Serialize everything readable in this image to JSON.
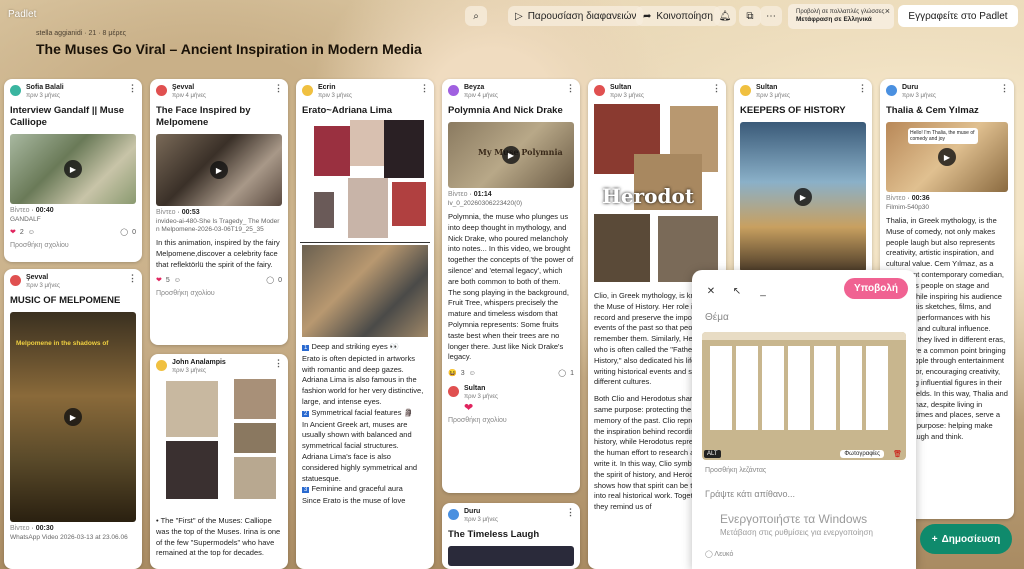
{
  "app": {
    "brand": "Padlet"
  },
  "toolbar": {
    "slideshow": "Παρουσίαση διαφανειών",
    "share": "Κοινοποίηση",
    "subscribe": "Εγγραφείτε στο Padlet",
    "lang_line1": "Προβολή σε πολλαπλές γλώσσες",
    "lang_line2": "Μετάφραση σε Ελληνικά"
  },
  "board": {
    "meta": "stella aggianidi · 21 · 8 μέρες",
    "title": "The Muses Go Viral – Ancient Inspiration in Modern Media"
  },
  "colors": {
    "accent": "#f06292",
    "publish": "#0f8a6c"
  },
  "cards": [
    {
      "author": "Sofia Balali",
      "time": "πριν 3 μήνες",
      "title": "Interview Gandalf || Muse Calliope",
      "video": "Βίντεο",
      "dur": "00:40",
      "file": "GANDALF",
      "likes": "2",
      "comments": "0",
      "add": "Προσθήκη σχολίου"
    },
    {
      "author": "Şevval",
      "time": "πριν 3 μήνες",
      "title": "MUSIC OF MELPOMENE",
      "overlay": "Melpomene in the shadows of",
      "video": "Βίντεο",
      "dur": "00:30",
      "file": "WhatsApp Video 2026-03-13 at 23.06.06"
    },
    {
      "author": "Şevval",
      "time": "πριν 4 μήνες",
      "title": "The Face Inspired by Melpomene",
      "video": "Βίντεο",
      "dur": "00:53",
      "file": "invideo-ai-480-She Is Tragedy_ The Modern Melpomene-2026-03-06T19_25_35",
      "body": "In this animation, inspired by the fairy Melpomene,discover a celebrity face that reflektörlü the spirit of the fairy.",
      "likes": "5",
      "comments": "0",
      "add": "Προσθήκη σχολίου"
    },
    {
      "author": "John Analampis",
      "time": "πριν 3 μήνες",
      "body": "• The \"First\" of the Muses: Calliope was the top of the Muses. Irina is one of the few \"Supermodels\" who have remained at the top for decades."
    },
    {
      "author": "Ecrin",
      "time": "πριν 3 μήνες",
      "title": "Erato~Adriana Lima",
      "p1h": "Deep and striking eyes 👀",
      "p1": "Erato is often depicted in artworks with romantic and deep gazes.",
      "p2": "Adriana Lima is also famous in the fashion world for her very distinctive, large, and intense eyes.",
      "p3h": "Symmetrical facial features 🗿",
      "p3": "In Ancient Greek art, muses are usually shown with balanced and symmetrical facial structures.",
      "p4": "Adriana Lima's face is also considered highly symmetrical and statuesque.",
      "p5h": "Feminine and graceful aura",
      "p5": "Since Erato is the muse of love"
    },
    {
      "author": "Beyza",
      "time": "πριν 4 μήνες",
      "title": "Polymnia And Nick Drake",
      "media_text": "My Muse Polymnia",
      "video": "Βίντεο",
      "dur": "01:14",
      "file": "lv_0_20260306223420(0)",
      "body": "Polymnia, the muse who plunges us into deep thought in mythology, and Nick Drake, who poured melancholy into notes... In this video, we brought together the concepts of 'the power of silence' and 'eternal legacy', which are both common to both of them. The song playing in the background, Fruit Tree, whispers precisely the mature and timeless wisdom that Polymnia represents: Some fruits taste best when their trees are no longer there.  Just like Nick Drake's legacy.",
      "likes": "3",
      "comments": "1",
      "reply_author": "Sultan",
      "reply_time": "πριν 3 μήνες",
      "add": "Προσθήκη σχολίου"
    },
    {
      "author": "Duru",
      "time": "πριν 3 μήνες",
      "title": "The Timeless Laugh"
    },
    {
      "author": "Sultan",
      "time": "πριν 3 μήνες",
      "media_text": "Herodot",
      "body1": "Clio, in Greek mythology, is known as the Muse of History. Her role is to record and preserve the important events of the past so that people can remember them. Similarly, Herodotus, who is often called the \"Father of History,\" also dedicated his life to writing historical events and stories of different cultures.",
      "body2": "Both Clio and Herodotus share the same purpose: protecting the memory of the past. Clio represents the inspiration behind recording history, while Herodotus represents the human effort to research and write it. In this way, Clio symbolizes the spirit of history, and Herodotus shows how that spirit can be turned into real historical work. Together, they remind us of"
    },
    {
      "author": "Sultan",
      "time": "πριν 3 μήνες",
      "title": "KEEPERS OF HISTORY"
    },
    {
      "author": "Duru",
      "time": "πριν 3 μήνες",
      "title": "Thalia & Cem Yılmaz",
      "media_text": "Hello! I'm Thalia, the muse of comedy and joy",
      "video": "Βίντεο",
      "dur": "00:36",
      "file": "Filmim-540p30",
      "body": "Thalia, in Greek mythology, is the Muse of comedy, not only makes people laugh but also represents creativity, artistic inspiration, and cultural value. Cem Yılmaz, as a prominent contemporary comedian, entertains people on stage and screen while inspiring his audience through his sketches, films, and stand-up performances with his creativity and cultural influence. Although they lived in different eras, both share a common point bringing joy to people through entertainment and humor, encouraging creativity, and being influential figures in their cultural fields. In this way, Thalia and Cem Yılmaz, despite living in different times and places, serve a common purpose: helping make people laugh and think."
    }
  ],
  "editor": {
    "subject": "Θέμα",
    "post": "Υποβολή",
    "caption": "Προσθήκη λεζάντας",
    "write": "Γράψτε κάτι απίθανο...",
    "alt": "ALT",
    "photos": "Φωτογραφίες",
    "white": "Λευκό"
  },
  "windows": {
    "line1": "Ενεργοποιήστε τα Windows",
    "line2": "Μετάβαση στις ρυθμίσεις για ενεργοποίηση"
  },
  "publish": "Δημοσίευση"
}
